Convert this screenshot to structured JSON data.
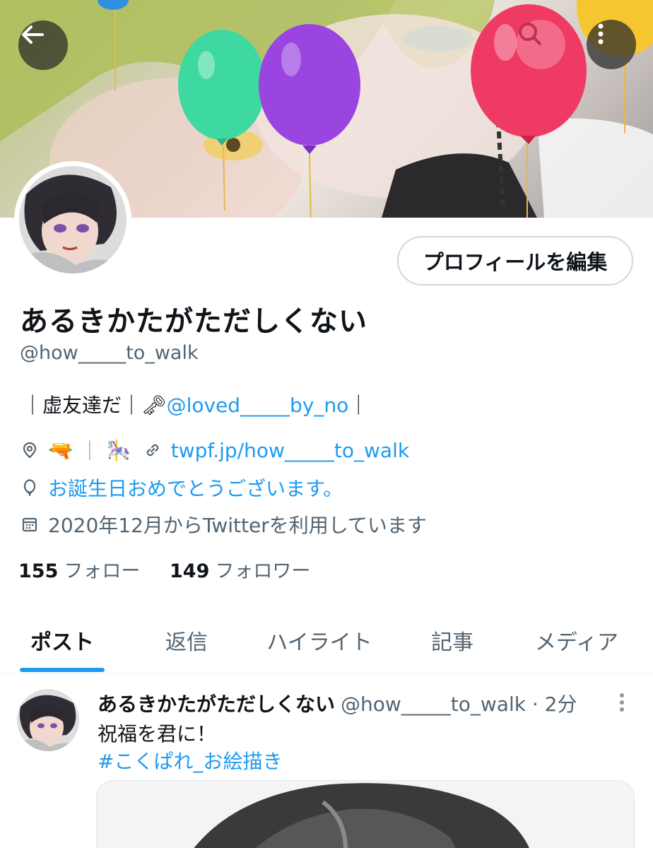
{
  "profile": {
    "display_name": "あるきかたがただしくない",
    "handle": "@how_____to_walk",
    "edit_button_label": "プロフィールを編集",
    "bio": {
      "part1": "｜虚友達だ｜",
      "key_emoji": "🗝",
      "mention": "@loved_____by_no",
      "part2": "｜"
    },
    "location": {
      "emoji_gun": "🔫",
      "sep": "｜",
      "emoji_carousel": "🎠"
    },
    "website": "twpf.jp/how_____to_walk",
    "birthday": "お誕生日おめでとうございます。",
    "joined": "2020年12月からTwitterを利用しています",
    "following_count": "155",
    "following_label": "フォロー",
    "followers_count": "149",
    "followers_label": "フォロワー"
  },
  "tabs": [
    {
      "label": "ポスト",
      "active": true
    },
    {
      "label": "返信",
      "active": false
    },
    {
      "label": "ハイライト",
      "active": false
    },
    {
      "label": "記事",
      "active": false
    },
    {
      "label": "メディア",
      "active": false
    }
  ],
  "post": {
    "author_name": "あるきかたがただしくない",
    "author_handle_time": "@how_____to_walk · 2分",
    "text": "祝福を君に！",
    "hashtag": "#こくぱれ_お絵描き"
  },
  "colors": {
    "accent": "#1d9bf0",
    "text_primary": "#0f1419",
    "text_secondary": "#536471",
    "border": "#cfd9de"
  },
  "icons": [
    "back-arrow-icon",
    "search-icon",
    "more-vertical-icon",
    "location-pin-icon",
    "link-icon",
    "balloon-icon",
    "calendar-icon",
    "more-dots-icon"
  ]
}
